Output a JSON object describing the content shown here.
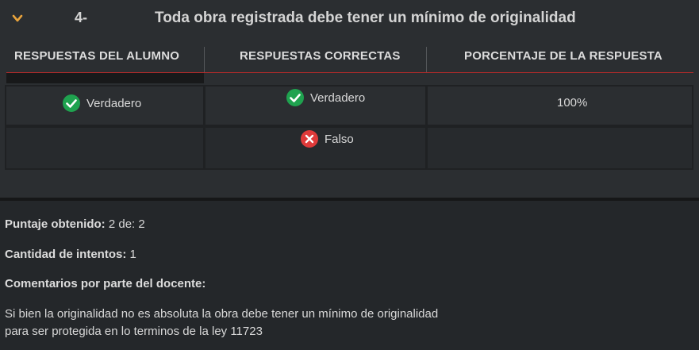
{
  "question": {
    "number": "4-",
    "title": "Toda obra registrada debe tener un mínimo de originalidad",
    "chevron_icon": "chevron-down-icon",
    "accent_color": "#e8a33c"
  },
  "table": {
    "headers": [
      "RESPUESTAS DEL ALUMNO",
      "RESPUESTAS CORRECTAS",
      "PORCENTAJE DE LA RESPUESTA"
    ],
    "header_underline_color": "#b22a2a",
    "rows": [
      {
        "student_answer": {
          "icon": "check-circle-icon",
          "label": "Verdadero"
        },
        "correct_answer": {
          "icon": "check-circle-icon",
          "label": "Verdadero"
        },
        "percentage": "100%"
      },
      {
        "student_answer": null,
        "correct_answer": {
          "icon": "x-circle-icon",
          "label": "Falso"
        },
        "percentage": ""
      }
    ],
    "colors": {
      "correct": "#1fa24f",
      "incorrect": "#e03a3a"
    }
  },
  "summary": {
    "score_label": "Puntaje obtenido:",
    "score_value": "2 de: 2",
    "attempts_label": "Cantidad de intentos:",
    "attempts_value": "1",
    "comments_label": "Comentarios por parte del docente:",
    "comment_line_1": "Si bien la originalidad no es absoluta la obra debe tener un mínimo de originalidad",
    "comment_line_2": "para ser protegida en lo terminos de la ley 11723"
  }
}
